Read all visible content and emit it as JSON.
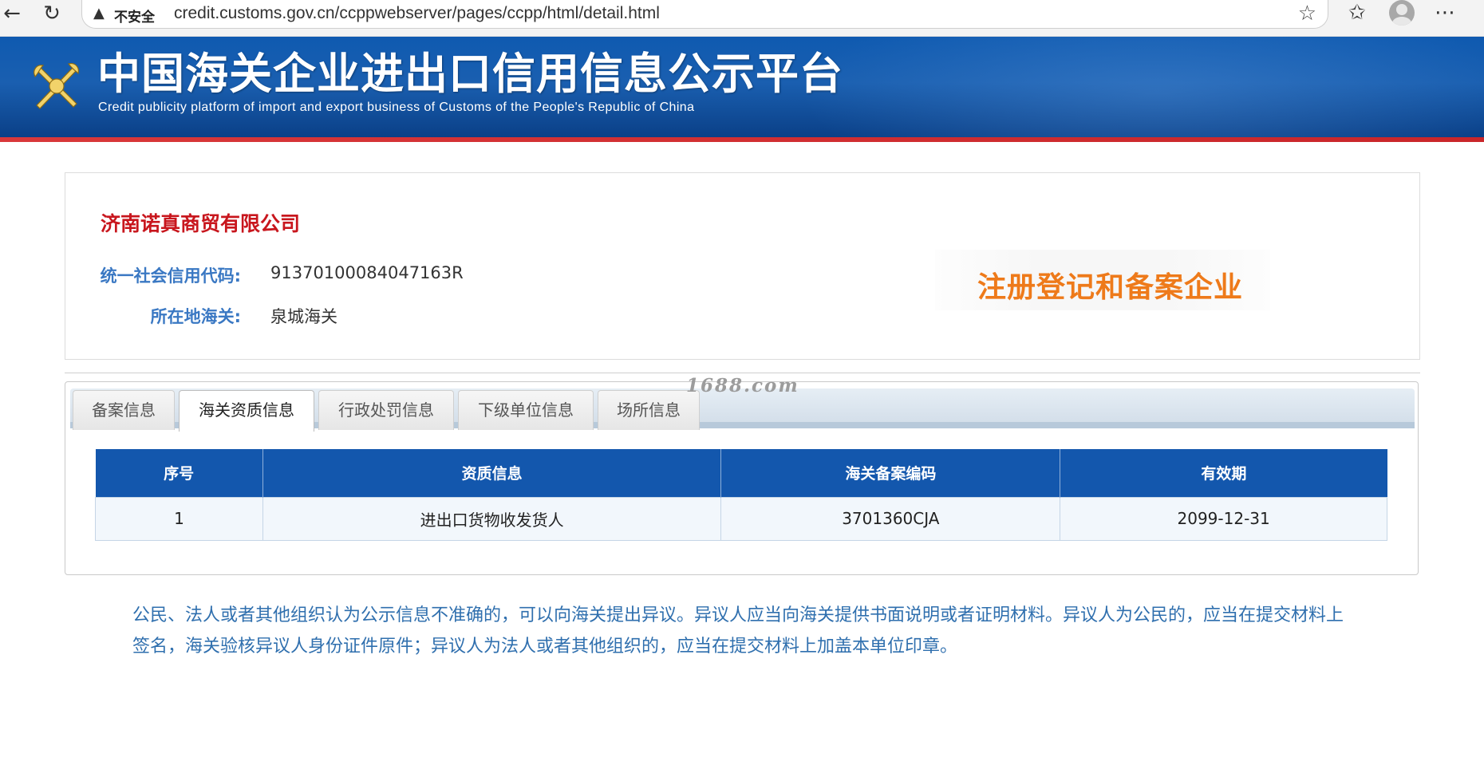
{
  "browser": {
    "back_icon": "arrow-left-icon",
    "reload_icon": "reload-icon",
    "security_warning": "不安全",
    "url": "credit.customs.gov.cn/ccppwebserver/pages/ccpp/html/detail.html"
  },
  "header": {
    "title": "中国海关企业进出口信用信息公示平台",
    "subtitle": "Credit publicity platform of import and export business of Customs of the People's Republic of China"
  },
  "company": {
    "name": "济南诺真商贸有限公司",
    "credit_code_label": "统一社会信用代码:",
    "credit_code_value": "91370100084047163R",
    "customs_label": "所在地海关:",
    "customs_value": "泉城海关",
    "status_stamp": "注册登记和备案企业"
  },
  "tabs": [
    {
      "label": "备案信息",
      "active": false
    },
    {
      "label": "海关资质信息",
      "active": true
    },
    {
      "label": "行政处罚信息",
      "active": false
    },
    {
      "label": "下级单位信息",
      "active": false
    },
    {
      "label": "场所信息",
      "active": false
    }
  ],
  "watermark": "1688.com",
  "table": {
    "headers": [
      "序号",
      "资质信息",
      "海关备案编码",
      "有效期"
    ],
    "rows": [
      [
        "1",
        "进出口货物收发货人",
        "3701360CJA",
        "2099-12-31"
      ]
    ]
  },
  "notice": "公民、法人或者其他组织认为公示信息不准确的，可以向海关提出异议。异议人应当向海关提供书面说明或者证明材料。异议人为公民的，应当在提交材料上签名，海关验核异议人身份证件原件；异议人为法人或者其他组织的，应当在提交材料上加盖本单位印章。",
  "colors": {
    "header_blue": "#1357ad",
    "accent_red": "#c8161d",
    "label_blue": "#3a78c3",
    "stamp_orange": "#ee7a1a"
  }
}
